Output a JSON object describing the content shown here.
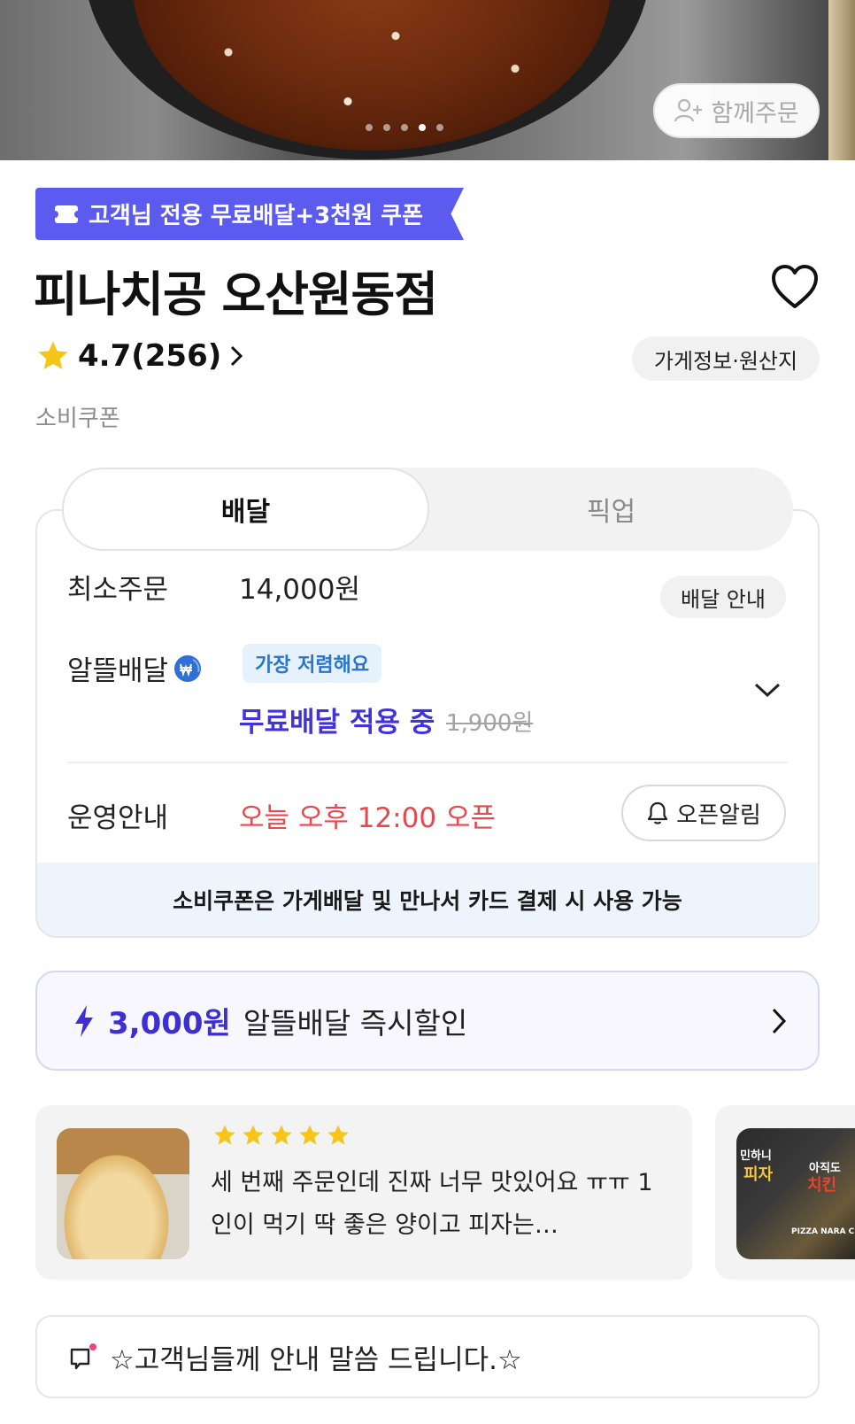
{
  "hero": {
    "group_order_label": "함께주문",
    "carousel_dots": 5,
    "carousel_active_index": 3
  },
  "coupon_banner": {
    "text": "고객님 전용 무료배달+3천원 쿠폰"
  },
  "store": {
    "name": "피나치공 오산원동점",
    "rating": "4.7(256)",
    "info_label": "가게정보·원산지",
    "sub_label": "소비쿠폰"
  },
  "tabs": [
    {
      "label": "배달",
      "active": true
    },
    {
      "label": "픽업",
      "active": false
    }
  ],
  "delivery": {
    "min_order_label": "최소주문",
    "min_order_value": "14,000원",
    "delivery_guide_label": "배달 안내",
    "saving_delivery_label": "알뜰배달",
    "cheapest_badge": "가장 저렴해요",
    "free_delivery_text": "무료배달 적용 중",
    "original_fee": "1,900원",
    "operation_label": "운영안내",
    "open_time": "오늘 오후 12:00 오픈",
    "open_alarm_label": "오픈알림",
    "notice_strip": "소비쿠폰은 가게배달 및 만나서 카드 결제 시 사용 가능"
  },
  "discount": {
    "amount": "3,000원",
    "description": "알뜰배달 즉시할인"
  },
  "reviews": [
    {
      "stars": 5,
      "text": "세 번째 주문인데 진짜 너무 맛있어요 ㅠㅠ 1인이 먹기 딱 좋은 양이고 피자는…"
    }
  ],
  "review2_thumb_text": {
    "line1": "민하니",
    "line2": "피자",
    "line3": "아직도",
    "line4": "치킨",
    "line5": "PIZZA NARA CH"
  },
  "notice": {
    "text": "☆고객님들께 안내 말씀 드립니다.☆"
  },
  "colors": {
    "brand_purple": "#5b5bf0",
    "discount_purple": "#3d2fd1",
    "open_red": "#e5484d",
    "star_yellow": "#f5c518",
    "badge_blue": "#2b74c9"
  }
}
